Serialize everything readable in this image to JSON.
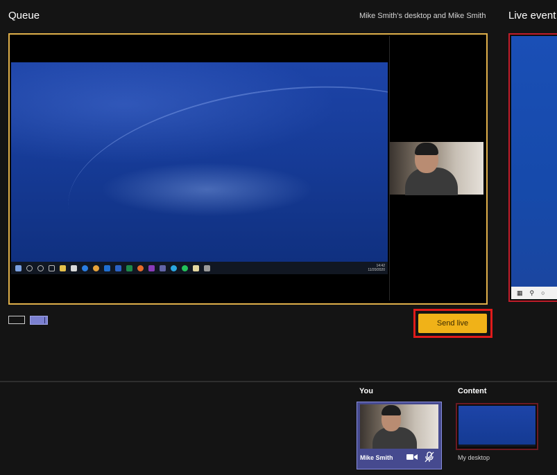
{
  "queue": {
    "title": "Queue",
    "sources_label": "Mike Smith's desktop and Mike Smith",
    "taskbar_clock_time": "14:42",
    "taskbar_clock_date": "11/20/2020"
  },
  "live_event": {
    "title": "Live event"
  },
  "send_live": {
    "label": "Send live"
  },
  "tiles": {
    "you_heading": "You",
    "content_heading": "Content",
    "you_name": "Mike Smith",
    "content_name": "My desktop"
  },
  "colors": {
    "queue_border": "#e0b04a",
    "live_border": "#c21d2a",
    "send_button": "#f0b218",
    "highlight": "#e01b1b",
    "you_tile": "#464a8f"
  },
  "icons": {
    "layout_single": "layout-single-icon",
    "layout_split": "layout-split-icon",
    "video": "video-camera-icon",
    "mic": "microphone-off-icon"
  }
}
